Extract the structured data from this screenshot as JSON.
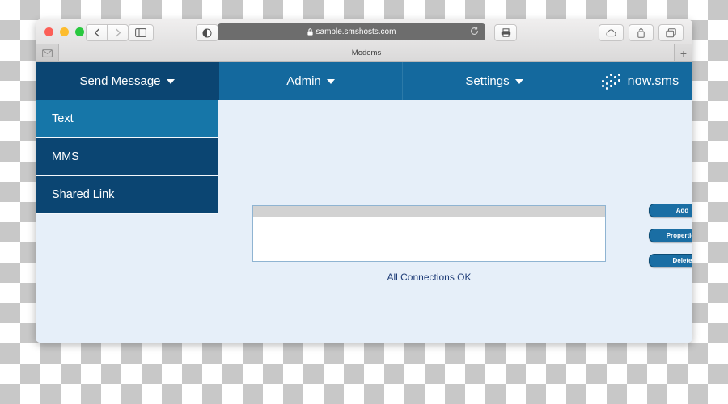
{
  "browser": {
    "url": "sample.smshosts.com",
    "lock_icon": "lock-icon",
    "tab_title": "Modems",
    "new_tab_label": "+",
    "back_icon": "chevron-left-icon",
    "forward_icon": "chevron-right-icon",
    "sidebar_icon": "sidebar-toggle-icon",
    "shield_icon": "privacy-shield-icon",
    "reload_icon": "reload-icon",
    "print_icon": "printer-icon",
    "cloud_icon": "cloud-icon",
    "share_icon": "share-icon",
    "tabs_icon": "show-all-tabs-icon",
    "mail_icon": "mail-icon"
  },
  "navbar": {
    "items": [
      {
        "label": "Send Message",
        "caret": "chevron-down-icon",
        "active": true
      },
      {
        "label": "Admin",
        "caret": "chevron-down-icon",
        "active": false
      },
      {
        "label": "Settings",
        "caret": "chevron-down-icon",
        "active": false
      }
    ],
    "logo_text": "now.sms",
    "logo_icon": "now-sms-dots-logo"
  },
  "dropdown": {
    "items": [
      {
        "label": "Text",
        "hover": true
      },
      {
        "label": "MMS",
        "hover": false
      },
      {
        "label": "Shared Link",
        "hover": false
      }
    ]
  },
  "main": {
    "status_text": "All Connections OK",
    "buttons": [
      {
        "label": "Add"
      },
      {
        "label": "Properties"
      },
      {
        "label": "Delete"
      }
    ]
  },
  "colors": {
    "nav_active": "#0b4572",
    "nav_base": "#14699e",
    "page_bg": "#e6eff9",
    "status_text": "#1f3d78",
    "button_bg": "#1a6ea4"
  }
}
